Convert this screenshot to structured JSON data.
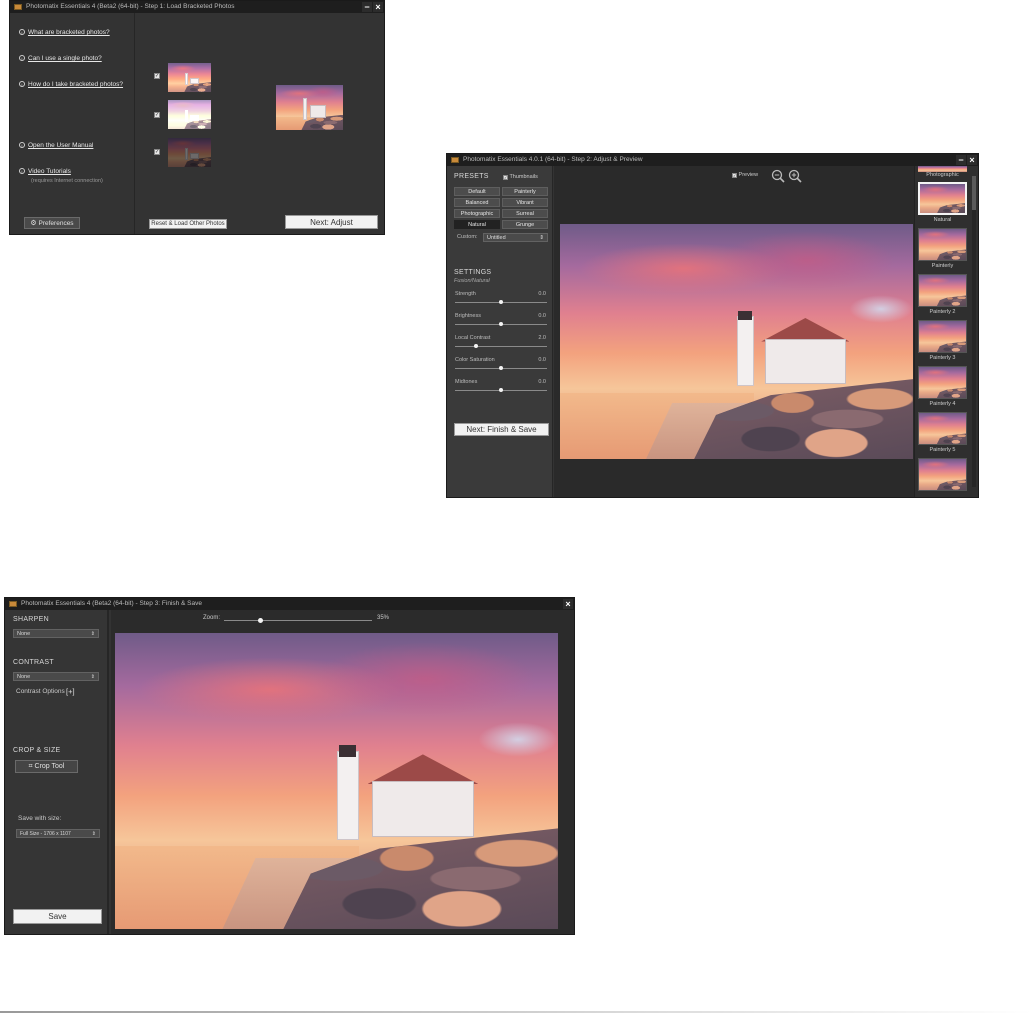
{
  "step1": {
    "title": "Photomatix Essentials 4 (Beta2 (64-bit) - Step 1: Load Bracketed Photos",
    "links": [
      "What are bracketed photos?",
      "Can I use a single photo?",
      "How do I take bracketed photos?",
      "Open the User Manual",
      "Video Tutorials"
    ],
    "video_note": "(requires Internet connection)",
    "preferences_label": "Preferences",
    "reset_label": "Reset & Load Other Photos",
    "next_label": "Next: Adjust"
  },
  "step2": {
    "title": "Photomatix Essentials 4.0.1 (64-bit) - Step 2: Adjust & Preview",
    "presets_heading": "PRESETS",
    "thumbnails_label": "Thumbnails",
    "preview_label": "Preview",
    "presets": [
      "Default",
      "Painterly",
      "Balanced",
      "Vibrant",
      "Photographic",
      "Surreal",
      "Natural",
      "Grunge"
    ],
    "custom_label": "Custom:",
    "custom_value": "Untitled",
    "settings_heading": "SETTINGS",
    "settings_subheading": "Fusion/Natural",
    "sliders": [
      {
        "label": "Strength",
        "value": "0.0",
        "level": 0.5
      },
      {
        "label": "Brightness",
        "value": "0.0",
        "level": 0.5
      },
      {
        "label": "Local Contrast",
        "value": "2.0",
        "level": 0.23
      },
      {
        "label": "Color Saturation",
        "value": "0.0",
        "level": 0.5
      },
      {
        "label": "Midtones",
        "value": "0.0",
        "level": 0.5
      }
    ],
    "next_label": "Next: Finish & Save",
    "thumb_top_label": "Photographic",
    "thumb_labels": [
      "Natural",
      "Painterly",
      "Painterly 2",
      "Painterly 3",
      "Painterly 4",
      "Painterly 5"
    ]
  },
  "step3": {
    "title": "Photomatix Essentials 4 (Beta2 (64-bit) - Step 3: Finish & Save",
    "sharpen_heading": "SHARPEN",
    "sharpen_value": "None",
    "contrast_heading": "CONTRAST",
    "contrast_value": "None",
    "contrast_options_label": "Contrast Options",
    "contrast_options_btn": "[+]",
    "crop_heading": "CROP & SIZE",
    "crop_tool_label": "Crop Tool",
    "save_size_label": "Save with size:",
    "save_size_value": "Full Size - 1706 x 1107",
    "save_label": "Save",
    "zoom_label": "Zoom:",
    "zoom_value": "35%",
    "zoom_level": 0.24
  }
}
